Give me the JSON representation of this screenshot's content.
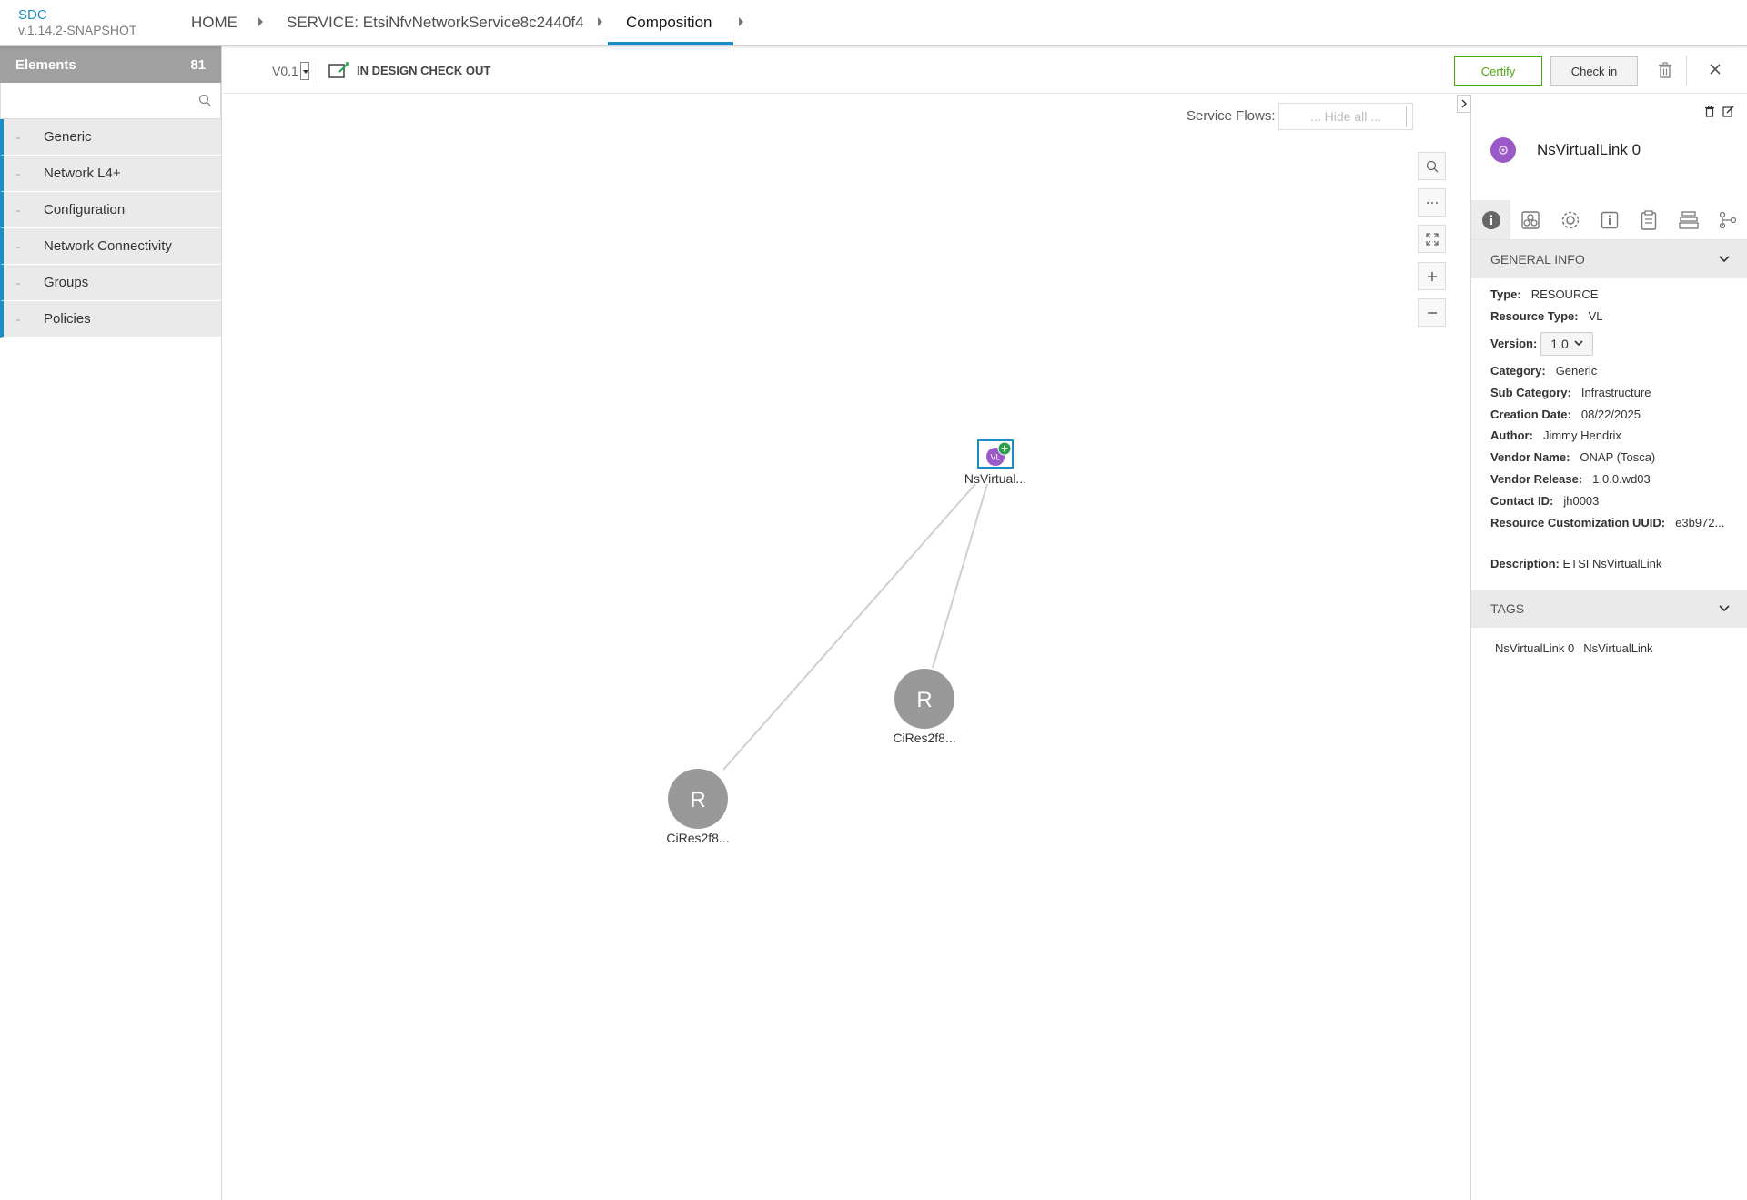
{
  "app": {
    "name": "SDC",
    "version": "v.1.14.2-SNAPSHOT"
  },
  "breadcrumb": {
    "home": "HOME",
    "service": "SERVICE: EtsiNfvNetworkService8c2440f4",
    "current": "Composition"
  },
  "left_panel": {
    "title": "Elements",
    "count": "81",
    "search_placeholder": "",
    "items": [
      {
        "label": "Generic"
      },
      {
        "label": "Network L4+"
      },
      {
        "label": "Configuration"
      },
      {
        "label": "Network Connectivity"
      },
      {
        "label": "Groups"
      },
      {
        "label": "Policies"
      }
    ]
  },
  "toolbar": {
    "version": "V0.1",
    "status": "IN DESIGN CHECK OUT",
    "certify_label": "Certify",
    "checkin_label": "Check in"
  },
  "canvas": {
    "service_flows_label": "Service Flows:",
    "service_flows_value": "... Hide all ...",
    "nodes": [
      {
        "label": "NsVirtual...",
        "icon_text": "VL"
      },
      {
        "label": "CiRes2f8...",
        "icon_text": "R"
      },
      {
        "label": "CiRes2f8...",
        "icon_text": "R"
      }
    ]
  },
  "right_panel": {
    "title": "NsVirtualLink 0",
    "sections": {
      "general": "GENERAL INFO",
      "tags": "TAGS"
    },
    "info": {
      "type_label": "Type:",
      "type": "RESOURCE",
      "resource_type_label": "Resource Type:",
      "resource_type": "VL",
      "version_label": "Version:",
      "version": "1.0",
      "category_label": "Category:",
      "category": "Generic",
      "sub_category_label": "Sub Category:",
      "sub_category": "Infrastructure",
      "creation_date_label": "Creation Date:",
      "creation_date": "08/22/2025",
      "author_label": "Author:",
      "author": "Jimmy Hendrix",
      "vendor_name_label": "Vendor Name:",
      "vendor_name": "ONAP (Tosca)",
      "vendor_release_label": "Vendor Release:",
      "vendor_release": "1.0.0.wd03",
      "contact_id_label": "Contact ID:",
      "contact_id": "jh0003",
      "uuid_label": "Resource Customization UUID:",
      "uuid": "e3b972...",
      "description_label": "Description:",
      "description": "ETSI NsVirtualLink"
    },
    "tags": [
      "NsVirtualLink 0",
      "NsVirtualLink"
    ]
  },
  "colors": {
    "accent": "#1d8ec3",
    "certify": "#4ca90c",
    "vl_purple": "#9b59c8",
    "node_gray": "#999999"
  }
}
